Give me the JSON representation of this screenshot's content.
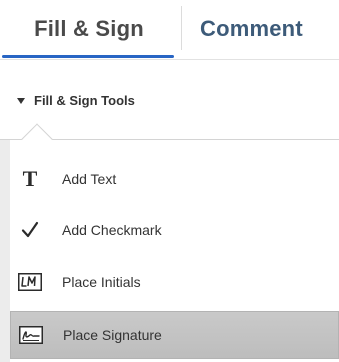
{
  "tabs": [
    {
      "label": "Fill & Sign",
      "active": true
    },
    {
      "label": "Comment",
      "active": false
    }
  ],
  "section": {
    "title": "Fill & Sign Tools",
    "expanded": true
  },
  "tools": [
    {
      "label": "Add Text",
      "icon": "text-t-icon"
    },
    {
      "label": "Add Checkmark",
      "icon": "checkmark-icon"
    },
    {
      "label": "Place Initials",
      "icon": "initials-icon"
    },
    {
      "label": "Place Signature",
      "icon": "signature-icon",
      "selected": true
    }
  ],
  "colors": {
    "active_tab_underline": "#2865c4",
    "comment_tab_text": "#3d5b79",
    "selected_row": "#c4c4c4"
  }
}
